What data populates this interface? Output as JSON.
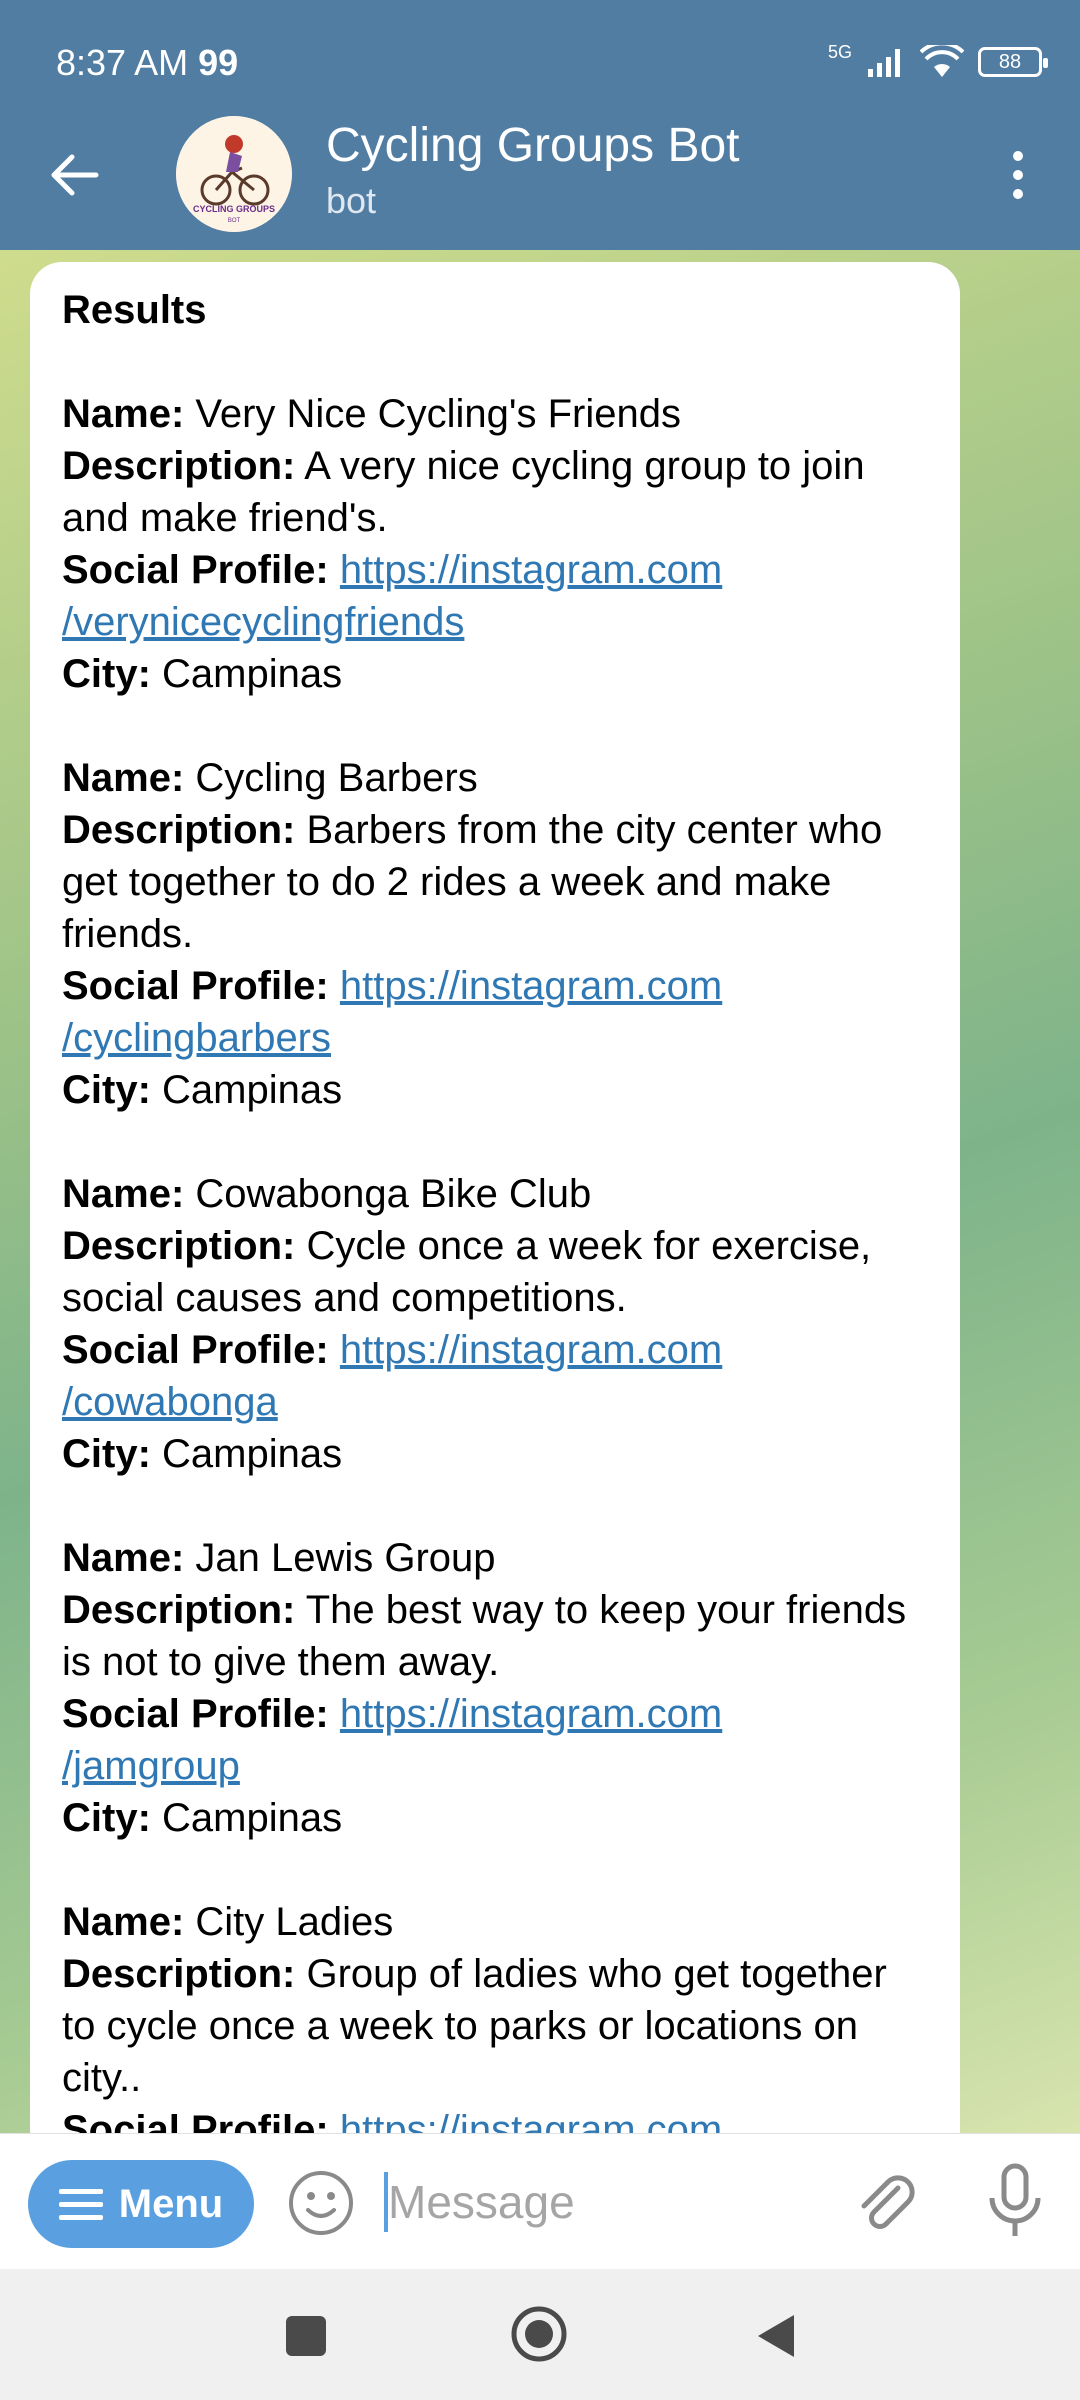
{
  "status_bar": {
    "time": "8:37 AM",
    "notification_badge": "99",
    "network": "5G",
    "battery": "88"
  },
  "header": {
    "title": "Cycling Groups Bot",
    "subtitle": "bot",
    "avatar_text": "CYCLING GROUPS",
    "avatar_subtext": "BOT",
    "bg_color": "#517da2"
  },
  "message": {
    "title": "Results",
    "labels": {
      "name": "Name:",
      "description": "Description:",
      "social": "Social Profile:",
      "city": "City:"
    },
    "entries": [
      {
        "name": "Very Nice Cycling's Friends",
        "description": "A very nice cycling group to join and make friend's.",
        "social_line1": "https://instagram.com",
        "social_line2": "/verynicecyclingfriends",
        "city": "Campinas"
      },
      {
        "name": "Cycling Barbers",
        "description": "Barbers from the city center who get together to do 2 rides a week and make friends.",
        "social_line1": "https://instagram.com",
        "social_line2": "/cyclingbarbers",
        "city": "Campinas"
      },
      {
        "name": "Cowabonga Bike Club",
        "description": "Cycle once a week for exercise, social causes and competitions.",
        "social_line1": "https://instagram.com",
        "social_line2": "/cowabonga",
        "city": "Campinas"
      },
      {
        "name": "Jan Lewis Group",
        "description": "The best way to keep your friends is not to give them away.",
        "social_line1": "https://instagram.com",
        "social_line2": "/jamgroup",
        "city": "Campinas"
      },
      {
        "name": "City Ladies",
        "description": "Group of ladies who get together to cycle once a week to  parks or locations on city..",
        "social_line1": "https://instagram.com",
        "social_line2": "",
        "city": ""
      }
    ]
  },
  "input_bar": {
    "menu_label": "Menu",
    "placeholder": "Message",
    "accent_color": "#5a9fe0"
  },
  "icons": {
    "back": "arrow-left-icon",
    "more": "more-vertical-icon",
    "emoji": "emoji-icon",
    "attach": "paperclip-icon",
    "mic": "microphone-icon"
  }
}
